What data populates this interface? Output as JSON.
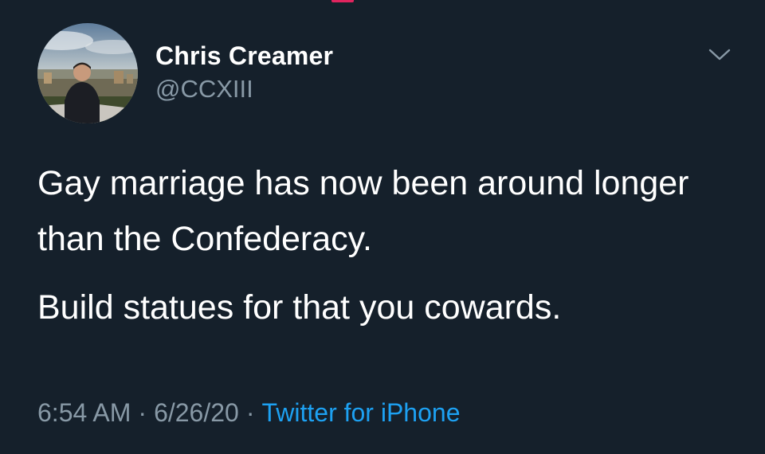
{
  "tweet": {
    "author": {
      "display_name": "Chris Creamer",
      "handle": "@CCXIII",
      "avatar_icon": "profile-photo"
    },
    "menu_icon": "chevron-down-icon",
    "text_paragraphs": [
      "Gay marriage has now been around longer than the Confederacy.",
      "Build statues for that you cowards."
    ],
    "time": "6:54 AM",
    "date": "6/26/20",
    "separator": "·",
    "source": "Twitter for iPhone"
  },
  "colors": {
    "background": "#15202b",
    "primary_text": "#ffffff",
    "secondary_text": "#8899a6",
    "link": "#1da1f2"
  }
}
